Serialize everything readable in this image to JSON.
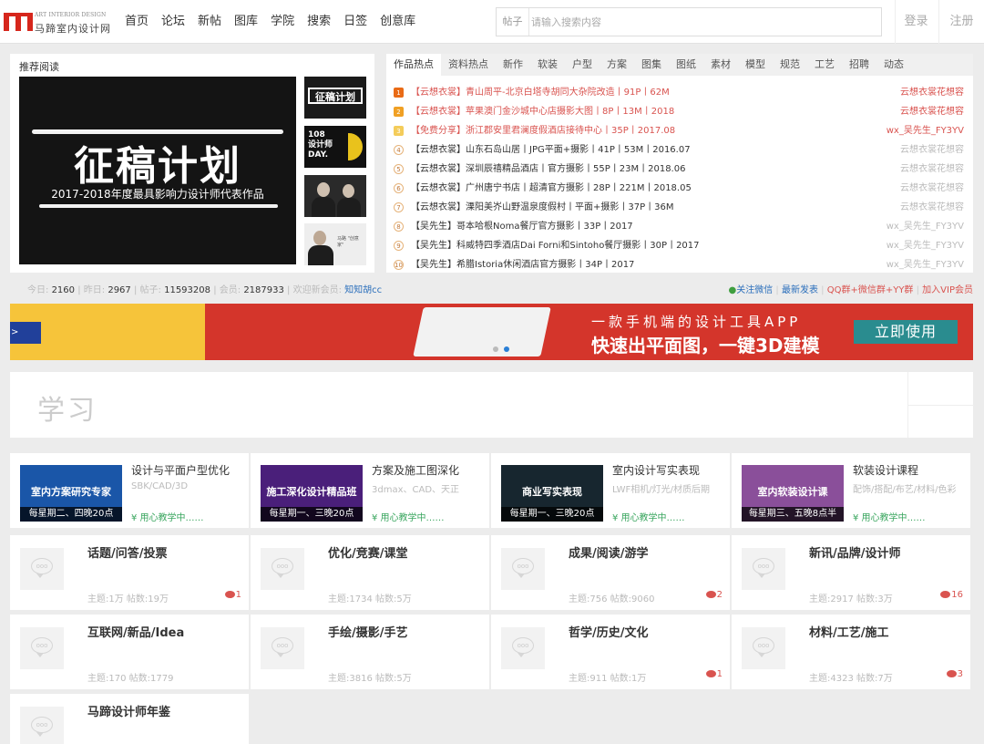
{
  "header": {
    "logo_en": "ART INTERIOR DESIGN",
    "logo_cn": "马蹄室内设计网",
    "nav": [
      "首页",
      "论坛",
      "新帖",
      "图库",
      "学院",
      "搜索",
      "日签",
      "创意库"
    ],
    "search_type": "帖子",
    "search_placeholder": "请输入搜索内容",
    "login": "登录",
    "register": "注册"
  },
  "recommend": {
    "title": "推荐阅读",
    "main_big": "征稿计划",
    "main_sub": "2017-2018年度最具影响力设计师代表作品",
    "thumb1_text": "征稿计划",
    "thumb2_line1": "108",
    "thumb2_line2": "设计师",
    "thumb2_line3": "DAY.",
    "thumb4_text": "马路 \"创意家\""
  },
  "hot": {
    "tabs": [
      "作品热点",
      "资料热点",
      "新作",
      "软装",
      "户型",
      "方案",
      "图集",
      "图纸",
      "素材",
      "模型",
      "规范",
      "工艺",
      "招聘",
      "动态"
    ],
    "items": [
      {
        "num": "1",
        "text": "【云想衣裳】青山周平-北京白塔寺胡同大杂院改造丨91P丨62M",
        "author": "云想衣裳花想容",
        "hl": true
      },
      {
        "num": "2",
        "text": "【云想衣裳】苹果澳门金沙城中心店摄影大图丨8P丨13M丨2018",
        "author": "云想衣裳花想容",
        "hl": true
      },
      {
        "num": "3",
        "text": "【免费分享】浙江郡安里君澜度假酒店接待中心丨35P丨2017.08",
        "author": "wx_吴先生_FY3YV",
        "hl": true
      },
      {
        "num": "4",
        "text": "【云想衣裳】山东石岛山居丨JPG平面+摄影丨41P丨53M丨2016.07",
        "author": "云想衣裳花想容",
        "hl": false
      },
      {
        "num": "5",
        "text": "【云想衣裳】深圳辰禧精品酒店丨官方摄影丨55P丨23M丨2018.06",
        "author": "云想衣裳花想容",
        "hl": false
      },
      {
        "num": "6",
        "text": "【云想衣裳】广州唐宁书店丨超清官方摄影丨28P丨221M丨2018.05",
        "author": "云想衣裳花想容",
        "hl": false
      },
      {
        "num": "7",
        "text": "【云想衣裳】溧阳美岕山野温泉度假村丨平面+摄影丨37P丨36M",
        "author": "云想衣裳花想容",
        "hl": false
      },
      {
        "num": "8",
        "text": "【吴先生】哥本哈根Noma餐厅官方摄影丨33P丨2017",
        "author": "wx_吴先生_FY3YV",
        "hl": false
      },
      {
        "num": "9",
        "text": "【吴先生】科威特四季酒店Dai Forni和Sintoho餐厅摄影丨30P丨2017",
        "author": "wx_吴先生_FY3YV",
        "hl": false
      },
      {
        "num": "10",
        "text": "【吴先生】希腊Istoria休闲酒店官方摄影丨34P丨2017",
        "author": "wx_吴先生_FY3YV",
        "hl": false
      }
    ]
  },
  "stats": {
    "today_label": "今日:",
    "today": "2160",
    "yesterday_label": "昨日:",
    "yesterday": "2967",
    "posts_label": "帖子:",
    "posts": "11593208",
    "members_label": "会员:",
    "members": "2187933",
    "welcome_label": "欢迎新会员:",
    "welcome": "知知胡cc"
  },
  "quick_links": {
    "wechat": "关注微信",
    "latest": "最新发表",
    "qq": "QQ群+微信群+YY群",
    "vip": "加入VIP会员"
  },
  "banner": {
    "line1": "一款手机端的设计工具APP",
    "line2": "快速出平面图，一键3D建模",
    "button": "立即使用",
    "arrow": ">"
  },
  "learn": {
    "title": "学习"
  },
  "courses": [
    {
      "title": "设计与平面户型优化",
      "sub": "SBK/CAD/3D",
      "price": "¥ 用心教学中……",
      "img_tag": "室内方案研究专家",
      "img_time": "每星期二、四晚20点",
      "bg": "#1a56a8"
    },
    {
      "title": "方案及施工图深化",
      "sub": "3dmax、CAD、天正",
      "price": "¥ 用心教学中……",
      "img_tag": "施工深化设计精品班",
      "img_time": "每星期一、三晚20点",
      "bg": "#4a1f7a"
    },
    {
      "title": "室内设计写实表现",
      "sub": "LWF相机/灯光/材质后期",
      "price": "¥ 用心教学中……",
      "img_tag": "商业写实表现",
      "img_time": "每星期一、三晚20点",
      "bg": "#17262f"
    },
    {
      "title": "软装设计课程",
      "sub": "配饰/搭配/布艺/材料/色彩",
      "price": "¥ 用心教学中……",
      "img_tag": "室内软装设计课",
      "img_time": "每星期三、五晚8点半",
      "bg": "#8a4f9a"
    }
  ],
  "forums": [
    {
      "title": "话题/问答/投票",
      "stats": "主题:1万  帖数:19万",
      "reply": "1"
    },
    {
      "title": "优化/竞赛/课堂",
      "stats": "主题:1734  帖数:5万",
      "reply": ""
    },
    {
      "title": "成果/阅读/游学",
      "stats": "主题:756  帖数:9060",
      "reply": "2"
    },
    {
      "title": "新讯/品牌/设计师",
      "stats": "主题:2917  帖数:3万",
      "reply": "16"
    },
    {
      "title": "互联网/新品/Idea",
      "stats": "主题:170  帖数:1779",
      "reply": ""
    },
    {
      "title": "手绘/摄影/手艺",
      "stats": "主题:3816  帖数:5万",
      "reply": ""
    },
    {
      "title": "哲学/历史/文化",
      "stats": "主题:911  帖数:1万",
      "reply": "1"
    },
    {
      "title": "材料/工艺/施工",
      "stats": "主题:4323  帖数:7万",
      "reply": "3"
    },
    {
      "title": "马蹄设计师年鉴",
      "stats": "",
      "reply": ""
    }
  ],
  "forum_icon_text": "ooo",
  "colors": {
    "brand": "#d6261c",
    "highlight": "#d9534f",
    "banner": "#d4352b",
    "button": "#2a8c8f",
    "price": "#3aa65f"
  }
}
